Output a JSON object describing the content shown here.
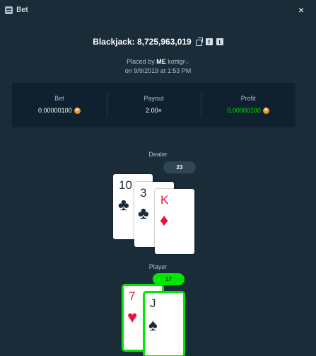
{
  "window": {
    "title": "Bet",
    "close_glyph": "×"
  },
  "header": {
    "game_title": "Blackjack: 8,725,963,019",
    "share": {
      "copy_icon": "copy-icon",
      "facebook_glyph": "f",
      "twitter_glyph": "t"
    }
  },
  "placed": {
    "prefix": "Placed by",
    "level": "ME",
    "username": "kottigr",
    "date": "on 9/9/2019 at 1:53 PM"
  },
  "stats": {
    "bet": {
      "label": "Bet",
      "value": "0.00000100"
    },
    "payout": {
      "label": "Payout",
      "value": "2.00×"
    },
    "profit": {
      "label": "Profit",
      "value": "0.00000100"
    },
    "coin_glyph": "B"
  },
  "dealer": {
    "label": "Dealer",
    "score": "23",
    "cards": [
      {
        "rank": "10",
        "suit": "♣"
      },
      {
        "rank": "3",
        "suit": "♣"
      },
      {
        "rank": "K",
        "suit": "♦"
      }
    ]
  },
  "player": {
    "label": "Player",
    "score": "17",
    "cards": [
      {
        "rank": "7",
        "suit": "♥"
      },
      {
        "rank": "J",
        "suit": "♠"
      }
    ]
  },
  "colors": {
    "background": "#1a2c38",
    "panel": "#0f212e",
    "win_green": "#00e701",
    "red_suit": "#e9113c",
    "coin": "#f7931a"
  }
}
